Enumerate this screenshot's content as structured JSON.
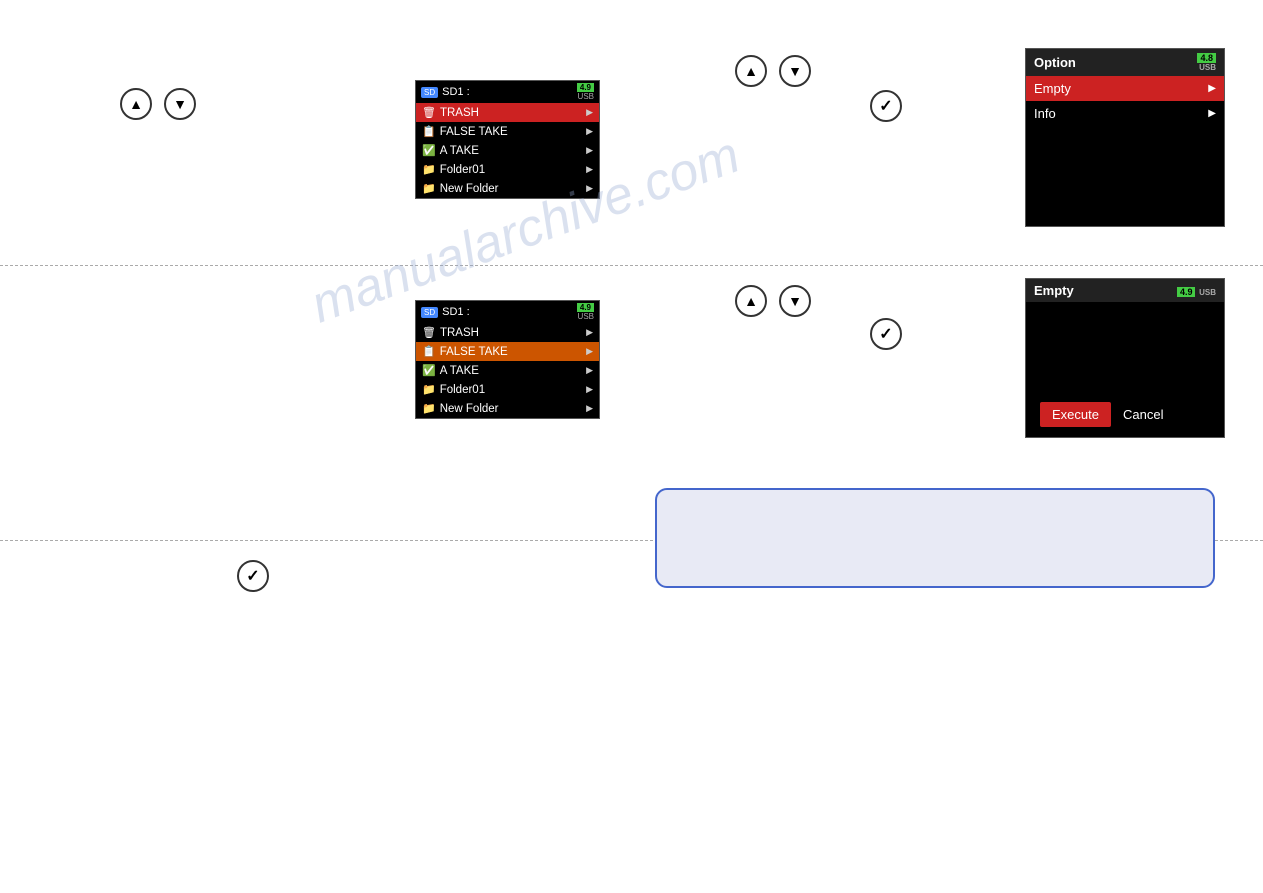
{
  "watermark": "manualarchive.com",
  "controls": {
    "up_arrow": "▲",
    "down_arrow": "▼",
    "check": "✓"
  },
  "screen1": {
    "title": "SD1 :",
    "battery": "4.9",
    "usb": "USB",
    "items": [
      {
        "icon": "🗑",
        "label": "TRASH",
        "selected": true,
        "color": "trash"
      },
      {
        "icon": "📋",
        "label": "FALSE TAKE",
        "selected": false,
        "color": "normal"
      },
      {
        "icon": "✅",
        "label": "A TAKE",
        "selected": false,
        "color": "normal"
      },
      {
        "icon": "📁",
        "label": "Folder01",
        "selected": false,
        "color": "normal"
      },
      {
        "icon": "📁",
        "label": "New Folder",
        "selected": false,
        "color": "normal"
      }
    ]
  },
  "screen2": {
    "title": "SD1 :",
    "battery": "4.9",
    "usb": "USB",
    "items": [
      {
        "icon": "🗑",
        "label": "TRASH",
        "selected": false,
        "color": "normal"
      },
      {
        "icon": "📋",
        "label": "FALSE TAKE",
        "selected": true,
        "color": "false-take"
      },
      {
        "icon": "✅",
        "label": "A TAKE",
        "selected": false,
        "color": "normal"
      },
      {
        "icon": "📁",
        "label": "Folder01",
        "selected": false,
        "color": "normal"
      },
      {
        "icon": "📁",
        "label": "New Folder",
        "selected": false,
        "color": "normal"
      }
    ]
  },
  "option_menu": {
    "title": "Option",
    "battery": "4.8",
    "usb": "USB",
    "items": [
      {
        "label": "Empty",
        "selected": true
      },
      {
        "label": "Info",
        "selected": false
      }
    ]
  },
  "empty_confirm": {
    "title": "Empty",
    "battery": "4.9",
    "usb": "USB",
    "execute_label": "Execute",
    "cancel_label": "Cancel"
  },
  "blue_box": {
    "content": ""
  }
}
